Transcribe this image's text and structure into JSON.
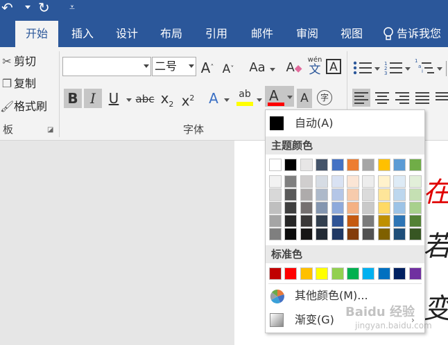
{
  "colors": {
    "ribbon_blue": "#2b579a",
    "font_color_underline": "#ff0000",
    "highlight_yellow": "#ffff00"
  },
  "qat": {
    "undo_icon": "undo-icon",
    "redo_icon": "redo-icon",
    "customize_icon": "customize-qat-icon"
  },
  "tabs": [
    {
      "label": "开始",
      "active": true
    },
    {
      "label": "插入",
      "active": false
    },
    {
      "label": "设计",
      "active": false
    },
    {
      "label": "布局",
      "active": false
    },
    {
      "label": "引用",
      "active": false
    },
    {
      "label": "邮件",
      "active": false
    },
    {
      "label": "审阅",
      "active": false
    },
    {
      "label": "视图",
      "active": false
    }
  ],
  "tell_me": {
    "label": "告诉我您"
  },
  "clipboard": {
    "cut": "剪切",
    "copy": "复制",
    "format_painter": "格式刷",
    "group_label": "板"
  },
  "font_group": {
    "font_name_value": "",
    "font_size_value": "二号",
    "grow": "A",
    "shrink": "A",
    "change_case": "Aa",
    "clear_format": "A",
    "phonetic_top": "wén",
    "phonetic_bottom": "文",
    "char_border": "A",
    "bold": "B",
    "italic": "I",
    "underline": "U",
    "strike": "abc",
    "subscript_base": "x",
    "subscript_sub": "2",
    "superscript_base": "x",
    "superscript_sup": "2",
    "text_effects": "A",
    "highlight": "ab",
    "font_color": "A",
    "char_shading": "A",
    "enclose": "字",
    "group_label": "字体"
  },
  "paragraph_group": {
    "multilevel_sub": "1",
    "multilevel_sub2": "a",
    "multilevel_sub3": "i"
  },
  "color_menu": {
    "auto_label": "自动(A)",
    "theme_header": "主题颜色",
    "theme_top_row": [
      "#ffffff",
      "#000000",
      "#e7e6e6",
      "#44546a",
      "#4472c4",
      "#ed7d31",
      "#a5a5a5",
      "#ffc000",
      "#5b9bd5",
      "#70ad47"
    ],
    "theme_shades": [
      [
        "#f2f2f2",
        "#7f7f7f",
        "#d0cece",
        "#d6dce4",
        "#d9e2f3",
        "#fbe5d5",
        "#ededed",
        "#fff2cc",
        "#deebf6",
        "#e2efd9"
      ],
      [
        "#d8d8d8",
        "#595959",
        "#aeabab",
        "#adb9ca",
        "#b4c6e7",
        "#f7cbac",
        "#dbdbdb",
        "#fee599",
        "#bdd7ee",
        "#c5e0b3"
      ],
      [
        "#bfbfbf",
        "#3f3f3f",
        "#757070",
        "#8496b0",
        "#8eaadb",
        "#f4b183",
        "#c9c9c9",
        "#ffd965",
        "#9dc3e6",
        "#a8d08d"
      ],
      [
        "#a5a5a5",
        "#262626",
        "#3a3838",
        "#323f4f",
        "#2f5496",
        "#c55a11",
        "#7b7b7b",
        "#bf9000",
        "#2e75b5",
        "#538135"
      ],
      [
        "#7f7f7f",
        "#0c0c0c",
        "#171616",
        "#222a35",
        "#1f3864",
        "#833c0b",
        "#525252",
        "#7f6000",
        "#1e4e79",
        "#375623"
      ]
    ],
    "standard_header": "标准色",
    "standard_colors": [
      "#c00000",
      "#ff0000",
      "#ffc000",
      "#ffff00",
      "#92d050",
      "#00b050",
      "#00b0f0",
      "#0070c0",
      "#002060",
      "#7030a0"
    ],
    "more_colors": "其他颜色(M)...",
    "gradient": "渐变(G)"
  },
  "document": {
    "glyph_1": "在",
    "glyph_2": "若",
    "glyph_3": "变"
  },
  "watermark": {
    "main": "Baidu 经验",
    "sub": "jingyan.baidu.com"
  }
}
